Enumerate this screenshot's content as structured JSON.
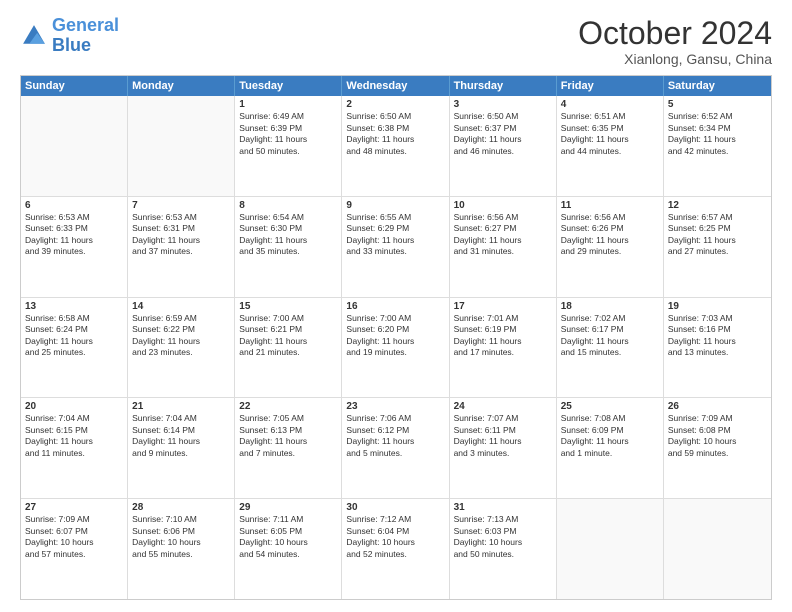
{
  "logo": {
    "line1": "General",
    "line2": "Blue"
  },
  "title": "October 2024",
  "subtitle": "Xianlong, Gansu, China",
  "headers": [
    "Sunday",
    "Monday",
    "Tuesday",
    "Wednesday",
    "Thursday",
    "Friday",
    "Saturday"
  ],
  "weeks": [
    [
      {
        "day": "",
        "lines": []
      },
      {
        "day": "",
        "lines": []
      },
      {
        "day": "1",
        "lines": [
          "Sunrise: 6:49 AM",
          "Sunset: 6:39 PM",
          "Daylight: 11 hours",
          "and 50 minutes."
        ]
      },
      {
        "day": "2",
        "lines": [
          "Sunrise: 6:50 AM",
          "Sunset: 6:38 PM",
          "Daylight: 11 hours",
          "and 48 minutes."
        ]
      },
      {
        "day": "3",
        "lines": [
          "Sunrise: 6:50 AM",
          "Sunset: 6:37 PM",
          "Daylight: 11 hours",
          "and 46 minutes."
        ]
      },
      {
        "day": "4",
        "lines": [
          "Sunrise: 6:51 AM",
          "Sunset: 6:35 PM",
          "Daylight: 11 hours",
          "and 44 minutes."
        ]
      },
      {
        "day": "5",
        "lines": [
          "Sunrise: 6:52 AM",
          "Sunset: 6:34 PM",
          "Daylight: 11 hours",
          "and 42 minutes."
        ]
      }
    ],
    [
      {
        "day": "6",
        "lines": [
          "Sunrise: 6:53 AM",
          "Sunset: 6:33 PM",
          "Daylight: 11 hours",
          "and 39 minutes."
        ]
      },
      {
        "day": "7",
        "lines": [
          "Sunrise: 6:53 AM",
          "Sunset: 6:31 PM",
          "Daylight: 11 hours",
          "and 37 minutes."
        ]
      },
      {
        "day": "8",
        "lines": [
          "Sunrise: 6:54 AM",
          "Sunset: 6:30 PM",
          "Daylight: 11 hours",
          "and 35 minutes."
        ]
      },
      {
        "day": "9",
        "lines": [
          "Sunrise: 6:55 AM",
          "Sunset: 6:29 PM",
          "Daylight: 11 hours",
          "and 33 minutes."
        ]
      },
      {
        "day": "10",
        "lines": [
          "Sunrise: 6:56 AM",
          "Sunset: 6:27 PM",
          "Daylight: 11 hours",
          "and 31 minutes."
        ]
      },
      {
        "day": "11",
        "lines": [
          "Sunrise: 6:56 AM",
          "Sunset: 6:26 PM",
          "Daylight: 11 hours",
          "and 29 minutes."
        ]
      },
      {
        "day": "12",
        "lines": [
          "Sunrise: 6:57 AM",
          "Sunset: 6:25 PM",
          "Daylight: 11 hours",
          "and 27 minutes."
        ]
      }
    ],
    [
      {
        "day": "13",
        "lines": [
          "Sunrise: 6:58 AM",
          "Sunset: 6:24 PM",
          "Daylight: 11 hours",
          "and 25 minutes."
        ]
      },
      {
        "day": "14",
        "lines": [
          "Sunrise: 6:59 AM",
          "Sunset: 6:22 PM",
          "Daylight: 11 hours",
          "and 23 minutes."
        ]
      },
      {
        "day": "15",
        "lines": [
          "Sunrise: 7:00 AM",
          "Sunset: 6:21 PM",
          "Daylight: 11 hours",
          "and 21 minutes."
        ]
      },
      {
        "day": "16",
        "lines": [
          "Sunrise: 7:00 AM",
          "Sunset: 6:20 PM",
          "Daylight: 11 hours",
          "and 19 minutes."
        ]
      },
      {
        "day": "17",
        "lines": [
          "Sunrise: 7:01 AM",
          "Sunset: 6:19 PM",
          "Daylight: 11 hours",
          "and 17 minutes."
        ]
      },
      {
        "day": "18",
        "lines": [
          "Sunrise: 7:02 AM",
          "Sunset: 6:17 PM",
          "Daylight: 11 hours",
          "and 15 minutes."
        ]
      },
      {
        "day": "19",
        "lines": [
          "Sunrise: 7:03 AM",
          "Sunset: 6:16 PM",
          "Daylight: 11 hours",
          "and 13 minutes."
        ]
      }
    ],
    [
      {
        "day": "20",
        "lines": [
          "Sunrise: 7:04 AM",
          "Sunset: 6:15 PM",
          "Daylight: 11 hours",
          "and 11 minutes."
        ]
      },
      {
        "day": "21",
        "lines": [
          "Sunrise: 7:04 AM",
          "Sunset: 6:14 PM",
          "Daylight: 11 hours",
          "and 9 minutes."
        ]
      },
      {
        "day": "22",
        "lines": [
          "Sunrise: 7:05 AM",
          "Sunset: 6:13 PM",
          "Daylight: 11 hours",
          "and 7 minutes."
        ]
      },
      {
        "day": "23",
        "lines": [
          "Sunrise: 7:06 AM",
          "Sunset: 6:12 PM",
          "Daylight: 11 hours",
          "and 5 minutes."
        ]
      },
      {
        "day": "24",
        "lines": [
          "Sunrise: 7:07 AM",
          "Sunset: 6:11 PM",
          "Daylight: 11 hours",
          "and 3 minutes."
        ]
      },
      {
        "day": "25",
        "lines": [
          "Sunrise: 7:08 AM",
          "Sunset: 6:09 PM",
          "Daylight: 11 hours",
          "and 1 minute."
        ]
      },
      {
        "day": "26",
        "lines": [
          "Sunrise: 7:09 AM",
          "Sunset: 6:08 PM",
          "Daylight: 10 hours",
          "and 59 minutes."
        ]
      }
    ],
    [
      {
        "day": "27",
        "lines": [
          "Sunrise: 7:09 AM",
          "Sunset: 6:07 PM",
          "Daylight: 10 hours",
          "and 57 minutes."
        ]
      },
      {
        "day": "28",
        "lines": [
          "Sunrise: 7:10 AM",
          "Sunset: 6:06 PM",
          "Daylight: 10 hours",
          "and 55 minutes."
        ]
      },
      {
        "day": "29",
        "lines": [
          "Sunrise: 7:11 AM",
          "Sunset: 6:05 PM",
          "Daylight: 10 hours",
          "and 54 minutes."
        ]
      },
      {
        "day": "30",
        "lines": [
          "Sunrise: 7:12 AM",
          "Sunset: 6:04 PM",
          "Daylight: 10 hours",
          "and 52 minutes."
        ]
      },
      {
        "day": "31",
        "lines": [
          "Sunrise: 7:13 AM",
          "Sunset: 6:03 PM",
          "Daylight: 10 hours",
          "and 50 minutes."
        ]
      },
      {
        "day": "",
        "lines": []
      },
      {
        "day": "",
        "lines": []
      }
    ]
  ]
}
